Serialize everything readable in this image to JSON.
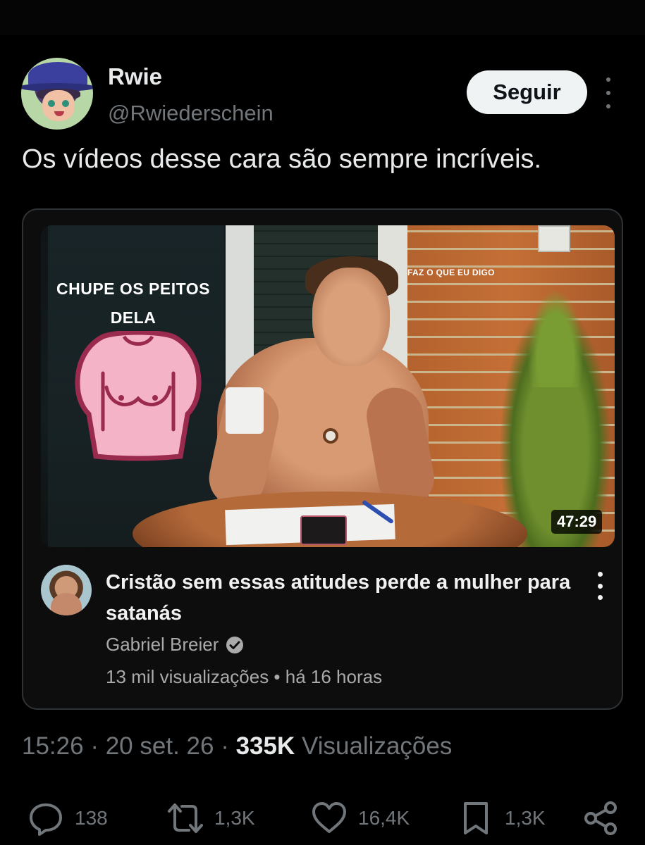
{
  "tweet": {
    "author_name": "Rwie",
    "author_handle": "@Rwiederschein",
    "follow_label": "Seguir",
    "text": "Os vídeos desse cara são sempre incríveis."
  },
  "video_card": {
    "thumbnail_text": "CHUPE OS PEITOS DELA",
    "thumbnail_small_text": "FAZ O QUE EU DIGO",
    "duration": "47:29",
    "title": "Cristão sem essas atitudes perde a mulher para satanás",
    "channel": "Gabriel Breier",
    "meta": "13 mil visualizações • há 16 horas"
  },
  "footer": {
    "time": "15:26",
    "date": "20 set. 26",
    "views_count": "335K",
    "views_label": "Visualizações"
  },
  "actions": {
    "replies": "138",
    "retweets": "1,3K",
    "likes": "16,4K",
    "bookmarks": "1,3K"
  },
  "colors": {
    "background": "#000000",
    "text_primary": "#e7e9ea",
    "text_secondary": "#71767b",
    "follow_bg": "#eff3f4",
    "card_border": "#2f3336"
  }
}
